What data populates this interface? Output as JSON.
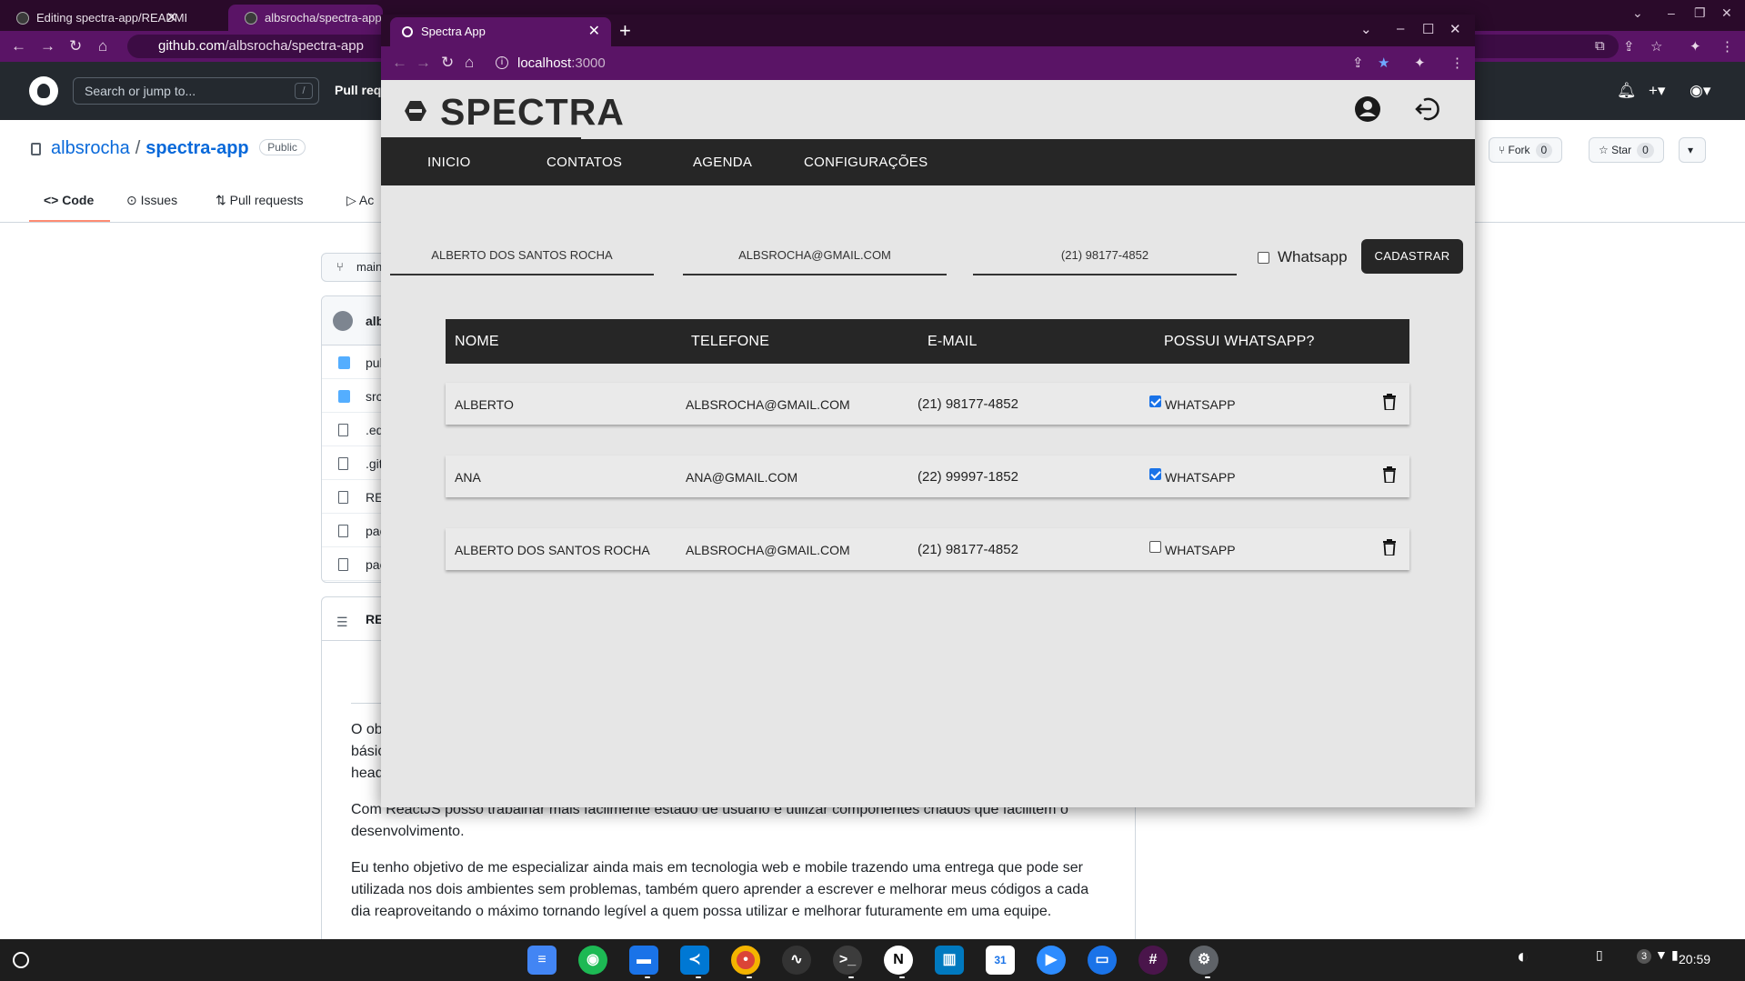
{
  "background_browser": {
    "tabs": [
      {
        "title": "Editing spectra-app/README.md"
      },
      {
        "title": "albsrocha/spectra-app: P"
      }
    ],
    "url_host": "github.com",
    "url_path": "/albsrocha/spectra-app",
    "github": {
      "search_placeholder": "Search or jump to...",
      "search_shortcut": "/",
      "pull_requests_link": "Pull req",
      "owner": "albsrocha",
      "repo": "spectra-app",
      "visibility": "Public",
      "fork_label": "Fork",
      "fork_count": "0",
      "star_label": "Star",
      "star_count": "0",
      "tabs": [
        "Code",
        "Issues",
        "Pull requests",
        "Ac"
      ],
      "branch": "main",
      "commit_author": "alb",
      "files": [
        {
          "name": "pul",
          "type": "folder"
        },
        {
          "name": "src",
          "type": "folder"
        },
        {
          "name": ".ed",
          "type": "file"
        },
        {
          "name": ".git",
          "type": "file"
        },
        {
          "name": "RE",
          "type": "file"
        },
        {
          "name": "pac",
          "type": "file"
        },
        {
          "name": "pac",
          "type": "file"
        }
      ],
      "readme_title": "RE",
      "readme_p1": "O ob básic head",
      "readme_p2": "Com ReactJS posso trabalhar mais facilmente estado de usuário e utilizar componentes criados que facilitem o desenvolvimento.",
      "readme_p3": "Eu tenho objetivo de me especializar ainda mais em tecnologia web e mobile trazendo uma entrega que pode ser utilizada nos dois ambientes sem problemas, também quero aprender a escrever e melhorar meus códigos a cada dia reaproveitando o máximo tornando legível a quem possa utilizar e melhorar futuramente em uma equipe."
    }
  },
  "window": {
    "tab_title": "Spectra App",
    "url_host": "localhost",
    "url_port": ":3000"
  },
  "app": {
    "brand": "SPECTRA",
    "nav": [
      "INICIO",
      "CONTATOS",
      "AGENDA",
      "CONFIGURAÇÕES"
    ],
    "form": {
      "name_value": "ALBERTO DOS SANTOS ROCHA",
      "email_value": "ALBSROCHA@GMAIL.COM",
      "phone_value": "(21) 98177-4852",
      "whatsapp_label": "Whatsapp",
      "whatsapp_checked": false,
      "submit_label": "CADASTRAR"
    },
    "table": {
      "headers": [
        "NOME",
        "TELEFONE",
        "E-MAIL",
        "POSSUI WHATSAPP?"
      ],
      "rows": [
        {
          "name": "ALBERTO",
          "email": "ALBSROCHA@GMAIL.COM",
          "phone": "(21) 98177-4852",
          "whatsapp": true,
          "whatsapp_label": "WHATSAPP"
        },
        {
          "name": "ANA",
          "email": "ANA@GMAIL.COM",
          "phone": "(22) 99997-1852",
          "whatsapp": true,
          "whatsapp_label": "WHATSAPP"
        },
        {
          "name": "ALBERTO DOS SANTOS ROCHA",
          "email": "ALBSROCHA@GMAIL.COM",
          "phone": "(21) 98177-4852",
          "whatsapp": false,
          "whatsapp_label": "WHATSAPP"
        }
      ]
    }
  },
  "shelf": {
    "apps": [
      "docs-icon",
      "spotify-icon",
      "files-icon",
      "vscode-icon",
      "chrome-icon",
      "stocks-icon",
      "terminal-icon",
      "notion-icon",
      "trello-icon",
      "calendar-icon",
      "zoom-icon",
      "messages-icon",
      "slack-icon",
      "settings-icon"
    ],
    "notification_count": "3",
    "time": "20:59"
  },
  "colors": {
    "chrome_frame": "#2a0a2a",
    "chrome_toolbar": "#5a1466",
    "app_dark": "#262626",
    "app_bg": "#e6e6e6",
    "checkbox_on": "#1a73e8"
  }
}
